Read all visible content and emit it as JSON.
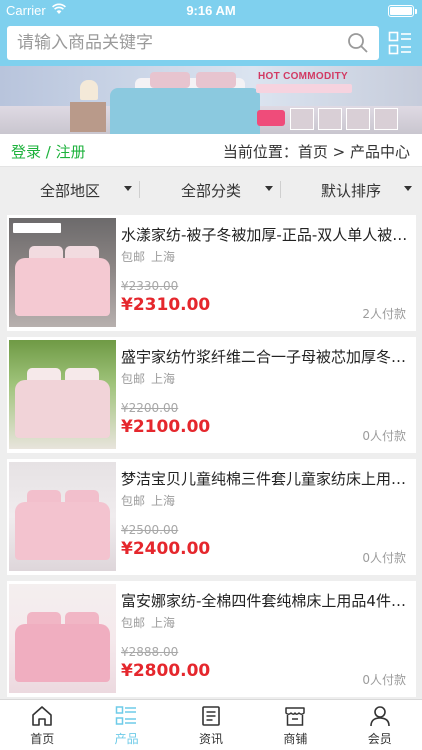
{
  "status_bar": {
    "carrier": "Carrier",
    "time": "9:16 AM"
  },
  "search": {
    "placeholder": "请输入商品关键字"
  },
  "banner": {
    "headline": "HOT COMMODITY"
  },
  "login_bar": {
    "login": "登录",
    "separator": " / ",
    "register": "注册",
    "location": "当前位置：首页 > 产品中心"
  },
  "filters": [
    {
      "label": "全部地区"
    },
    {
      "label": "全部分类"
    },
    {
      "label": "默认排序"
    }
  ],
  "products": [
    {
      "title": "水漾家纺-被子冬被加厚-正品-双人单人被…",
      "shipping": "包邮",
      "location": "上海",
      "old_price": "¥2330.00",
      "price": "¥2310.00",
      "sold": "2人付款"
    },
    {
      "title": "盛宇家纺竹浆纤维二合一子母被芯加厚冬…",
      "shipping": "包邮",
      "location": "上海",
      "old_price": "¥2200.00",
      "price": "¥2100.00",
      "sold": "0人付款"
    },
    {
      "title": "梦洁宝贝儿童纯棉三件套儿童家纺床上用…",
      "shipping": "包邮",
      "location": "上海",
      "old_price": "¥2500.00",
      "price": "¥2400.00",
      "sold": "0人付款"
    },
    {
      "title": "富安娜家纺-全棉四件套纯棉床上用品4件…",
      "shipping": "包邮",
      "location": "上海",
      "old_price": "¥2888.00",
      "price": "¥2800.00",
      "sold": "0人付款"
    }
  ],
  "tabbar": {
    "active": "产品",
    "items": [
      {
        "label": "首页",
        "icon": "home-icon"
      },
      {
        "label": "产品",
        "icon": "list-icon"
      },
      {
        "label": "资讯",
        "icon": "news-icon"
      },
      {
        "label": "商铺",
        "icon": "store-icon"
      },
      {
        "label": "会员",
        "icon": "user-icon"
      }
    ]
  },
  "colors": {
    "header": "#7fd0ee",
    "accent_green": "#1db23c",
    "price_red": "#e5272d",
    "tab_active": "#6ecbe8"
  }
}
